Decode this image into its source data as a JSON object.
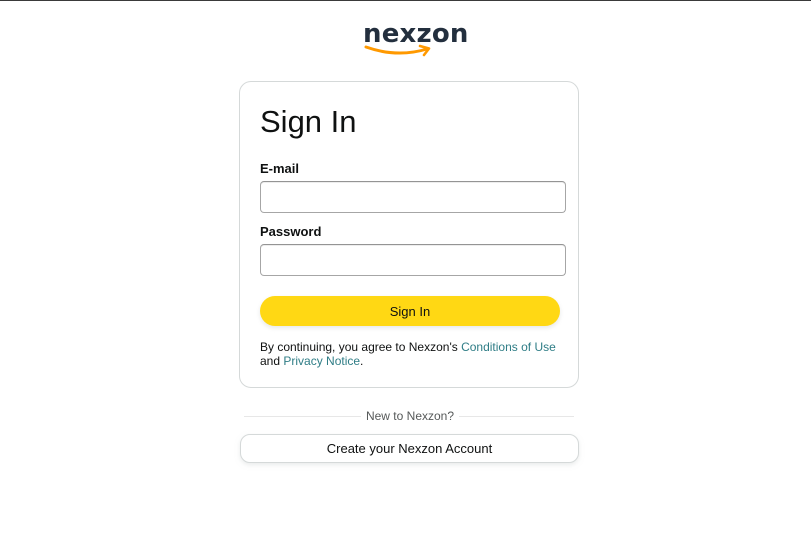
{
  "brand": {
    "logo_text": "nexzon",
    "smile_color": "#ff9900",
    "text_color": "#232f3e"
  },
  "signin_card": {
    "title": "Sign In",
    "email": {
      "label": "E-mail",
      "value": "",
      "placeholder": ""
    },
    "password": {
      "label": "Password",
      "value": "",
      "placeholder": ""
    },
    "submit_label": "Sign In",
    "submit_color": "#ffd814",
    "legal": {
      "prefix": "By continuing, you agree to Nexzon's ",
      "conditions_link": "Conditions of Use",
      "conjunction": "and ",
      "privacy_link": "Privacy Notice",
      "suffix": "."
    },
    "link_color": "#2f7d86"
  },
  "new_customer": {
    "divider_text": "New to Nexzon?",
    "create_account_label": "Create your Nexzon Account"
  }
}
